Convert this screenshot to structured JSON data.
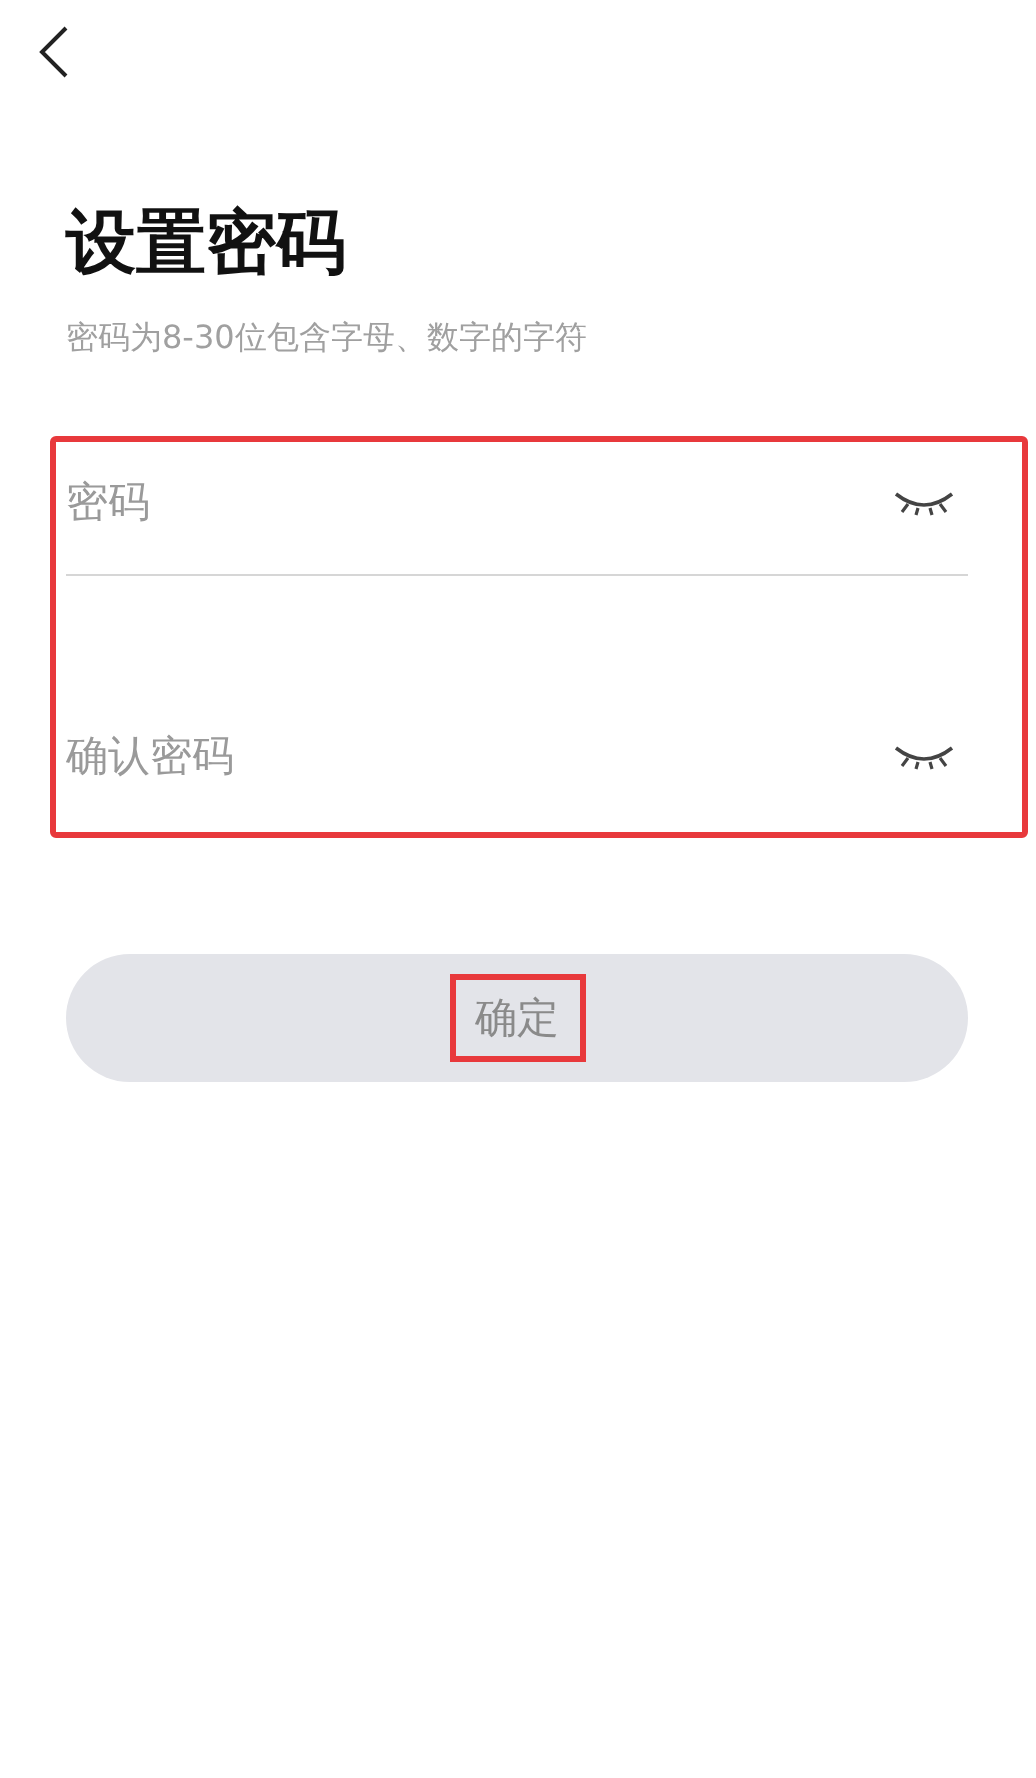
{
  "title": "设置密码",
  "subtitle": "密码为8-30位包含字母、数字的字符",
  "fields_highlighted": true,
  "fields": [
    {
      "placeholder": "密码"
    },
    {
      "placeholder": "确认密码"
    }
  ],
  "confirm_button": {
    "label": "确定",
    "disabled": true,
    "highlighted": true
  }
}
